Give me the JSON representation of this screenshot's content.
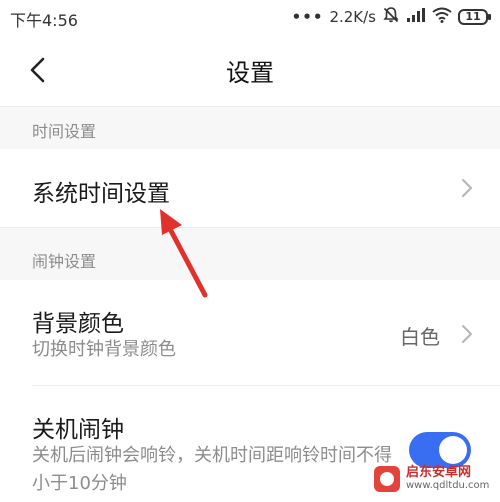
{
  "status_bar": {
    "time": "下午4:56",
    "network_dots": "•••",
    "speed": "2.2K/s",
    "battery": "11"
  },
  "title_bar": {
    "title": "设置"
  },
  "sections": [
    {
      "header": "时间设置",
      "rows": [
        {
          "title": "系统时间设置"
        }
      ]
    },
    {
      "header": "闹钟设置",
      "rows": [
        {
          "title": "背景颜色",
          "subtitle": "切换时钟背景颜色",
          "value": "白色"
        },
        {
          "title": "关机闹钟",
          "subtitle": "关机后闹钟会响铃，关机时间距响铃时间不得小于10分钟",
          "enabled": true
        }
      ]
    }
  ],
  "colors": {
    "toggle_on": "#3a6ef2",
    "annotation_arrow": "#e0322c"
  },
  "watermark": {
    "title": "启东安卓网",
    "url": "www.qdltdu.com"
  }
}
